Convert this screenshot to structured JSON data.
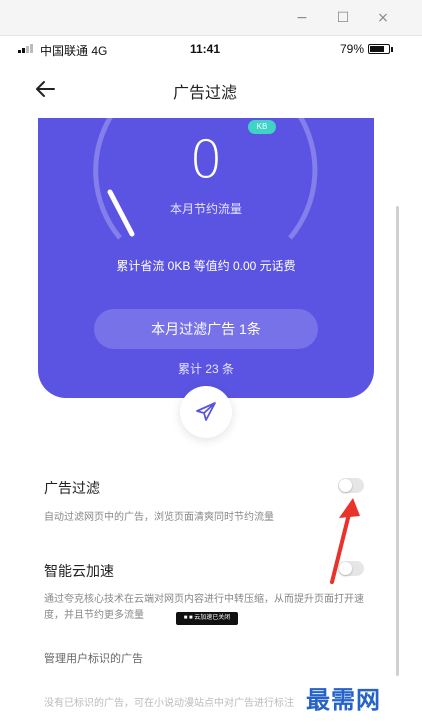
{
  "window": {
    "minimize_glyph": "−",
    "maximize_glyph": "☐",
    "close_glyph": "×"
  },
  "status_bar": {
    "carrier": "中国联通  4G",
    "time": "11:41",
    "battery_percent": "79%",
    "battery_level": 0.79
  },
  "nav": {
    "title": "广告过滤",
    "back_icon": "back-arrow-icon"
  },
  "hero": {
    "badge": "KB",
    "value": "0",
    "sublabel": "本月节约流量",
    "saved_text": "累计省流 0KB 等值约 0.00 元话费",
    "pill_text": "本月过滤广告 1条",
    "total_text": "累计 23 条",
    "color": "#5b54e3",
    "share_icon": "paper-plane-icon"
  },
  "settings": [
    {
      "title": "广告过滤",
      "desc": "自动过滤网页中的广告，浏览页面清爽同时节约流量",
      "enabled": false
    },
    {
      "title": "智能云加速",
      "desc": "通过夸克核心技术在云端对网页内容进行中转压缩，从而提升页面打开速度，并且节约更多流量",
      "enabled": false
    }
  ],
  "toast_text": "■ ■  云加速已关闭",
  "manage_label": "管理用户标识的广告",
  "bottom_hint": "没有已标识的广告，可在小说动漫站点中对广告进行标注",
  "watermark": "最需网",
  "colors": {
    "accent": "#5b54e3",
    "badge": "#3fd2c7",
    "annotation": "#e8322a",
    "watermark": "#2563c9"
  }
}
